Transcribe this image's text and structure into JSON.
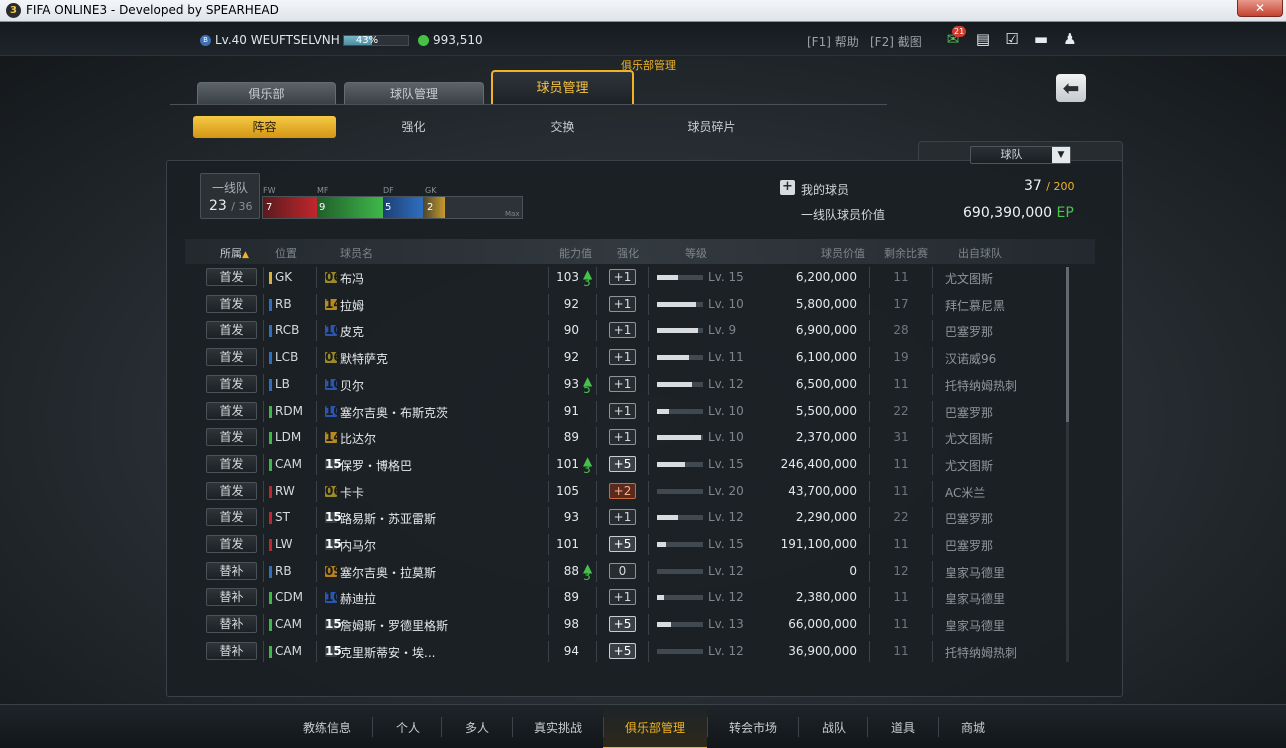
{
  "window": {
    "title": "FIFA ONLINE3 - Developed by SPEARHEAD",
    "app_icon": "3",
    "close_glyph": "✕"
  },
  "topbar": {
    "level_badge": "B",
    "level_text": "Lv.40 WEUFTSELVNH",
    "xp_percent": 43,
    "xp_label": "43%",
    "coins": "993,510",
    "help": "[F1] 帮助",
    "screenshot": "[F2] 截图",
    "mail_count": "21",
    "icons": [
      "mail-icon",
      "news-icon",
      "checklist-icon",
      "chat-icon",
      "user-icon"
    ]
  },
  "nav": {
    "section_label": "俱乐部管理",
    "tabs": [
      "俱乐部",
      "球队管理",
      "球员管理"
    ],
    "subtabs": [
      "阵容",
      "强化",
      "交换",
      "球员碎片"
    ]
  },
  "filter": {
    "selected": "球队"
  },
  "summary": {
    "first_team_label": "一线队",
    "first_team_count": "23",
    "first_team_total": "/ 36",
    "positions": [
      {
        "label": "FW",
        "count": "7",
        "color": "#c0272d"
      },
      {
        "label": "MF",
        "count": "9",
        "color": "#3fb84a"
      },
      {
        "label": "DF",
        "count": "5",
        "color": "#2f6fc0"
      },
      {
        "label": "GK",
        "count": "2",
        "color": "#c79a2c"
      }
    ],
    "max_label": "Max",
    "my_players_label": "我的球员",
    "my_players_count": "37",
    "my_players_max": "/ 200",
    "value_label": "一线队球员价值",
    "value_amount": "690,390,000",
    "value_unit": "EP"
  },
  "table": {
    "headers": [
      "所属",
      "位置",
      "球员名",
      "能力值",
      "强化",
      "等级",
      "球员价值",
      "剩余比赛",
      "出自球队"
    ],
    "sort_arrow": "▲",
    "rows": [
      {
        "role": "首发",
        "pos": "GK",
        "poscolor": "#d8b03a",
        "season": "06",
        "scolor": "#9a8a2a",
        "name": "布冯",
        "ovr": "103",
        "up": "3",
        "enh": "+1",
        "etype": "",
        "lvlfrac": 0.45,
        "lv": "Lv. 15",
        "price": "6,200,000",
        "games": "11",
        "club": "尤文图斯"
      },
      {
        "role": "首发",
        "pos": "RB",
        "poscolor": "#2f6fc0",
        "season": "14",
        "scolor": "#b78a1e",
        "name": "拉姆",
        "ovr": "92",
        "up": "",
        "enh": "+1",
        "etype": "",
        "lvlfrac": 0.85,
        "lv": "Lv. 10",
        "price": "5,800,000",
        "games": "17",
        "club": "拜仁慕尼黑"
      },
      {
        "role": "首发",
        "pos": "RCB",
        "poscolor": "#2f6fc0",
        "season": "10",
        "scolor": "#2a56b0",
        "name": "皮克",
        "ovr": "90",
        "up": "",
        "enh": "+1",
        "etype": "",
        "lvlfrac": 0.9,
        "lv": "Lv. 9",
        "price": "6,900,000",
        "games": "28",
        "club": "巴塞罗那"
      },
      {
        "role": "首发",
        "pos": "LCB",
        "poscolor": "#2f6fc0",
        "season": "06",
        "scolor": "#9a8a2a",
        "name": "默特萨克",
        "ovr": "92",
        "up": "",
        "enh": "+1",
        "etype": "",
        "lvlfrac": 0.7,
        "lv": "Lv. 11",
        "price": "6,100,000",
        "games": "19",
        "club": "汉诺威96"
      },
      {
        "role": "首发",
        "pos": "LB",
        "poscolor": "#2f6fc0",
        "season": "10",
        "scolor": "#2a56b0",
        "name": "贝尔",
        "ovr": "93",
        "up": "5",
        "enh": "+1",
        "etype": "",
        "lvlfrac": 0.75,
        "lv": "Lv. 12",
        "price": "6,500,000",
        "games": "11",
        "club": "托特纳姆热刺"
      },
      {
        "role": "首发",
        "pos": "RDM",
        "poscolor": "#3fb84a",
        "season": "10",
        "scolor": "#2a56b0",
        "name": "塞尔吉奥・布斯克茨",
        "ovr": "91",
        "up": "",
        "enh": "+1",
        "etype": "",
        "lvlfrac": 0.25,
        "lv": "Lv. 10",
        "price": "5,500,000",
        "games": "22",
        "club": "巴塞罗那"
      },
      {
        "role": "首发",
        "pos": "LDM",
        "poscolor": "#3fb84a",
        "season": "14",
        "scolor": "#b78a1e",
        "name": "比达尔",
        "ovr": "89",
        "up": "",
        "enh": "+1",
        "etype": "",
        "lvlfrac": 0.95,
        "lv": "Lv. 10",
        "price": "2,370,000",
        "games": "31",
        "club": "尤文图斯"
      },
      {
        "role": "首发",
        "pos": "CAM",
        "poscolor": "#3fb84a",
        "season": "15",
        "scolor": "#3a3f44",
        "name": "保罗・博格巴",
        "ovr": "101",
        "up": "3",
        "enh": "+5",
        "etype": "gold",
        "lvlfrac": 0.6,
        "lv": "Lv. 15",
        "price": "246,400,000",
        "games": "11",
        "club": "尤文图斯"
      },
      {
        "role": "首发",
        "pos": "RW",
        "poscolor": "#c0272d",
        "season": "06",
        "scolor": "#9a8a2a",
        "name": "卡卡",
        "ovr": "105",
        "up": "",
        "enh": "+2",
        "etype": "red",
        "lvlfrac": 0.0,
        "lv": "Lv. 20",
        "price": "43,700,000",
        "games": "11",
        "club": "AC米兰"
      },
      {
        "role": "首发",
        "pos": "ST",
        "poscolor": "#c0272d",
        "season": "15",
        "scolor": "#3a3f44",
        "name": "路易斯・苏亚雷斯",
        "ovr": "93",
        "up": "",
        "enh": "+1",
        "etype": "",
        "lvlfrac": 0.45,
        "lv": "Lv. 12",
        "price": "2,290,000",
        "games": "22",
        "club": "巴塞罗那"
      },
      {
        "role": "首发",
        "pos": "LW",
        "poscolor": "#c0272d",
        "season": "15",
        "scolor": "#3a3f44",
        "name": "内马尔",
        "ovr": "101",
        "up": "",
        "enh": "+5",
        "etype": "gold",
        "lvlfrac": 0.2,
        "lv": "Lv. 15",
        "price": "191,100,000",
        "games": "11",
        "club": "巴塞罗那"
      },
      {
        "role": "替补",
        "pos": "RB",
        "poscolor": "#2f6fc0",
        "season": "09",
        "scolor": "#b7801e",
        "name": "塞尔吉奥・拉莫斯",
        "ovr": "88",
        "up": "3",
        "enh": "0",
        "etype": "",
        "lvlfrac": 0.0,
        "lv": "Lv. 12",
        "price": "0",
        "games": "12",
        "club": "皇家马德里"
      },
      {
        "role": "替补",
        "pos": "CDM",
        "poscolor": "#3fb84a",
        "season": "10",
        "scolor": "#2a56b0",
        "name": "赫迪拉",
        "ovr": "89",
        "up": "",
        "enh": "+1",
        "etype": "",
        "lvlfrac": 0.15,
        "lv": "Lv. 12",
        "price": "2,380,000",
        "games": "11",
        "club": "皇家马德里"
      },
      {
        "role": "替补",
        "pos": "CAM",
        "poscolor": "#3fb84a",
        "season": "15",
        "scolor": "#3a3f44",
        "name": "詹姆斯・罗德里格斯",
        "ovr": "98",
        "up": "",
        "enh": "+5",
        "etype": "gold",
        "lvlfrac": 0.3,
        "lv": "Lv. 13",
        "price": "66,000,000",
        "games": "11",
        "club": "皇家马德里"
      },
      {
        "role": "替补",
        "pos": "CAM",
        "poscolor": "#3fb84a",
        "season": "15",
        "scolor": "#3a3f44",
        "name": "克里斯蒂安・埃...",
        "ovr": "94",
        "up": "",
        "enh": "+5",
        "etype": "gold",
        "lvlfrac": 0.0,
        "lv": "Lv. 12",
        "price": "36,900,000",
        "games": "11",
        "club": "托特纳姆热刺"
      }
    ]
  },
  "bottom_nav": [
    "教练信息",
    "个人",
    "多人",
    "真实挑战",
    "俱乐部管理",
    "转会市场",
    "战队",
    "道具",
    "商城"
  ]
}
